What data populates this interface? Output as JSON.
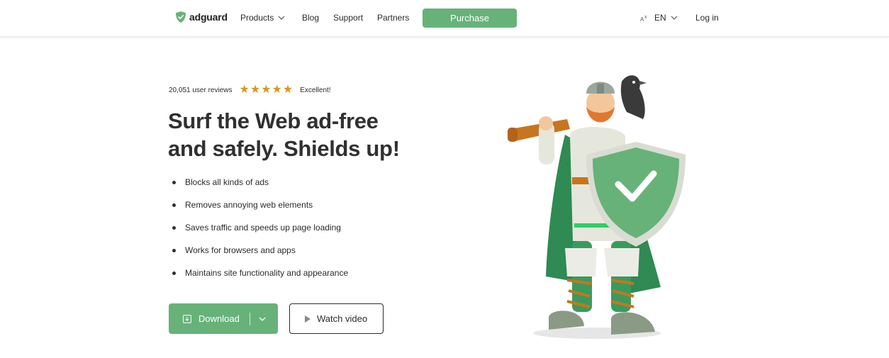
{
  "header": {
    "logo_text": "adguard",
    "nav": [
      {
        "label": "Products"
      },
      {
        "label": "Blog"
      },
      {
        "label": "Support"
      },
      {
        "label": "Partners"
      }
    ],
    "purchase_label": "Purchase",
    "language": "EN",
    "login_label": "Log in"
  },
  "hero": {
    "reviews_count": "20,051 user reviews",
    "rating_stars": 5,
    "rating_label": "Excellent!",
    "headline_line1": "Surf the Web ad-free",
    "headline_line2": "and safely. Shields up!",
    "features": [
      "Blocks all kinds of ads",
      "Removes annoying web elements",
      "Saves traffic and speeds up page loading",
      "Works for browsers and apps",
      "Maintains site functionality and appearance"
    ],
    "download_label": "Download",
    "watch_label": "Watch video"
  },
  "colors": {
    "accent": "#67b279",
    "star": "#d49a1e",
    "text": "#2b2b2b"
  },
  "icons": [
    "shield-logo-icon",
    "chevron-down-icon",
    "translate-icon",
    "star-icon",
    "download-icon",
    "play-icon"
  ]
}
